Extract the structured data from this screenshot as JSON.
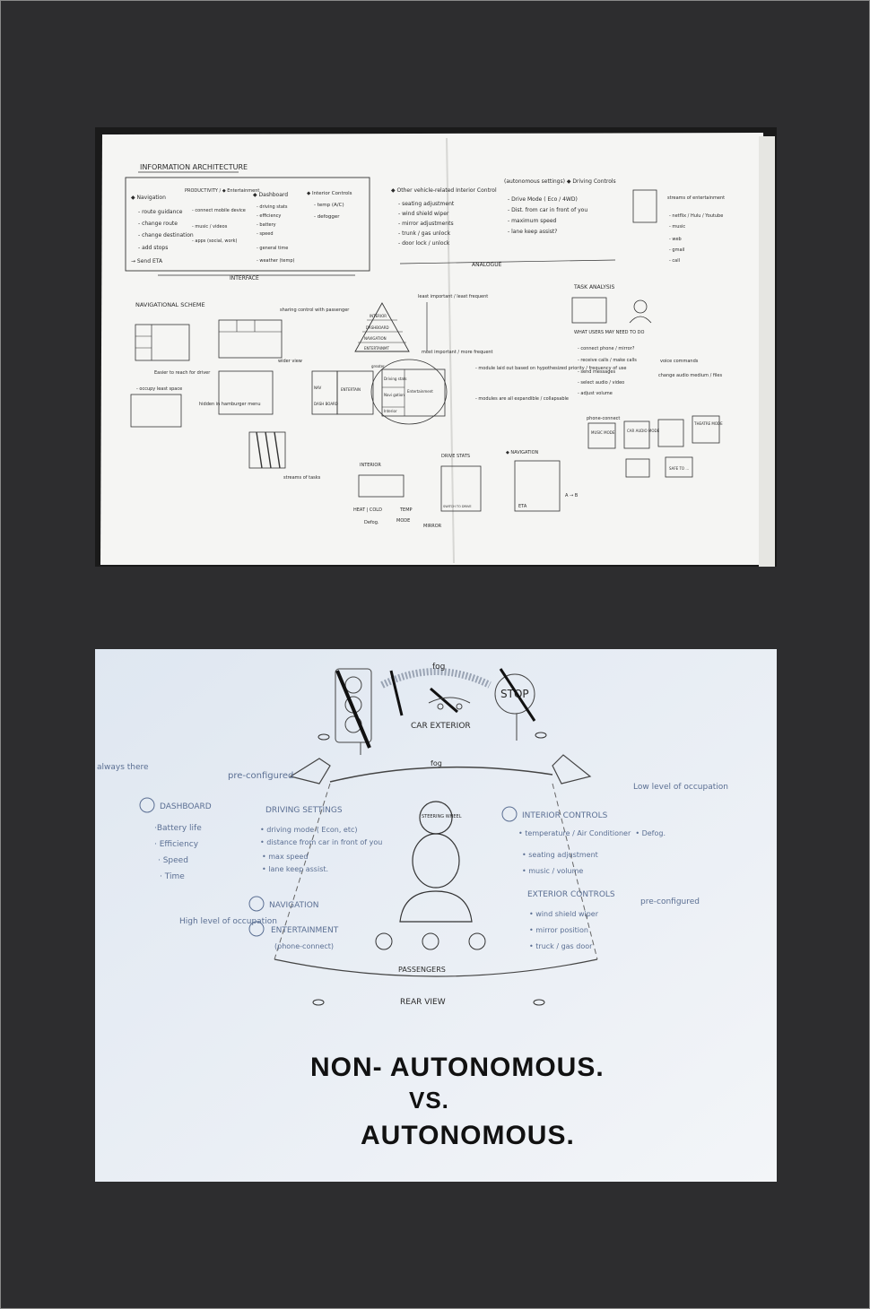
{
  "sketch1": {
    "ia": {
      "title": "INFORMATION ARCHITECTURE",
      "footer": "INTERFACE",
      "columns": [
        {
          "head": "◆ Navigation",
          "items": [
            "- route guidance",
            "- change route",
            "- change destination",
            "- add stops",
            "→ Send ETA"
          ]
        },
        {
          "head": "PRODUCTIVITY / ◆ Entertainment",
          "items": [
            "- connect mobile device",
            "- music / videos",
            "- apps (social, work)"
          ]
        },
        {
          "head": "◆ Dashboard",
          "items": [
            "- driving stats",
            "- efficiency",
            "- battery",
            "- speed",
            "- general time",
            "- weather (temp)"
          ]
        },
        {
          "head": "◆ Interior Controls",
          "items": [
            "- temp (A/C)",
            "- defogger"
          ]
        }
      ]
    },
    "analogue": {
      "left_head": "◆ Other vehicle-related Interior Control",
      "left_items": [
        "- seating adjustment",
        "- wind shield wiper",
        "- mirror adjustments",
        "- trunk / gas unlock",
        "- door lock / unlock"
      ],
      "right_head": "(autonomous settings) ◆ Driving Controls",
      "right_items": [
        "- Drive Mode ( Eco / 4WD)",
        "- Dist. from car in front of you",
        "- maximum speed",
        "- lane keep assist?"
      ],
      "footer": "ANALOGUE"
    },
    "streams": {
      "head": "streams of entertainment",
      "items": [
        "- netflix / Hulu / Youtube",
        "- music",
        "- web",
        "- gmail",
        "- call"
      ]
    },
    "nav_scheme": {
      "title": "NAVIGATIONAL SCHEME",
      "notes": [
        "sharing control with passenger",
        "wider view",
        "Easier to reach for driver",
        "- occupy least space",
        "hidden in hamburger menu",
        "streams of tasks"
      ]
    },
    "pyramid": {
      "tiers": [
        "INTERIOR",
        "DASHBOARD",
        "NAVIGATION",
        "ENTERTAINMT"
      ],
      "top_note": "least important / least frequent",
      "bottom_note": "most important / more frequent"
    },
    "layout": {
      "cells": [
        "NAV",
        "DASH BOARD",
        "ENTERTAIN",
        "Driving stats",
        "Navi gation",
        "Interior",
        "Entertainment"
      ],
      "notes": [
        "- module laid out based on hypothesized priority / frequency of use",
        "- modules are all expandible / collapsable"
      ],
      "greater": "greater"
    },
    "task": {
      "title": "TASK ANALYSIS",
      "subtitle": "WHAT USERS MAY NEED TO DO",
      "items": [
        "- connect phone / mirror?",
        "- receive calls / make calls",
        "- send messages",
        "- select audio / video",
        "- adjust volume"
      ],
      "voice": "voice commands",
      "change": "change audio medium / files",
      "modes": [
        "MUSIC MODE",
        "CAR AUDIO MODE",
        "",
        "THEATRE MODE"
      ],
      "phone": "phone-connect",
      "safe": "SAFE TO ..."
    },
    "screens": [
      {
        "title": "INTERIOR",
        "labels": [
          "HEAT | COLD",
          "TEMP",
          "Defog.",
          "MODE",
          "MIRROR"
        ]
      },
      {
        "title": "DRIVE STATS",
        "labels": [
          "SWITCH TO DRIVE"
        ]
      },
      {
        "title": "◆ NAVIGATION",
        "labels": [
          "ETA",
          "A → B"
        ]
      }
    ]
  },
  "sketch2": {
    "fog_top": "fog",
    "fog_mid": "fog",
    "exterior": "CAR EXTERIOR",
    "stop": "STOP",
    "always_there": "always there",
    "preconfigured_left": "pre-configured",
    "low_level": "Low level of occupation",
    "preconfigured_right": "pre-configured",
    "high_level": "High level of occupation",
    "steering": "STEERING WHEEL",
    "dashboard": {
      "title": "DASHBOARD",
      "items": [
        "·Battery life",
        "· Efficiency",
        "· Speed",
        "· Time"
      ]
    },
    "driving": {
      "title": "DRIVING SETTINGS",
      "items": [
        "• driving mode ( Econ, etc)",
        "• distance from car in front of you",
        "• max speed",
        "• lane keep assist."
      ]
    },
    "interior": {
      "title": "INTERIOR CONTROLS",
      "items": [
        "• temperature / Air Conditioner  • Defog.",
        "• seating adjustment",
        "• music / volume"
      ]
    },
    "exterior_ctrl": {
      "title": "EXTERIOR CONTROLS",
      "items": [
        "• wind shield wiper",
        "• mirror position",
        "• truck / gas door"
      ]
    },
    "navigation": "NAVIGATION",
    "entertainment": "ENTERTAINMENT",
    "phone_connect": "(phone-connect)",
    "passengers": "PASSENGERS",
    "rear": "REAR VIEW",
    "title_line1": "NON- AUTONOMOUS.",
    "title_line2": "VS.",
    "title_line3": "AUTONOMOUS."
  }
}
